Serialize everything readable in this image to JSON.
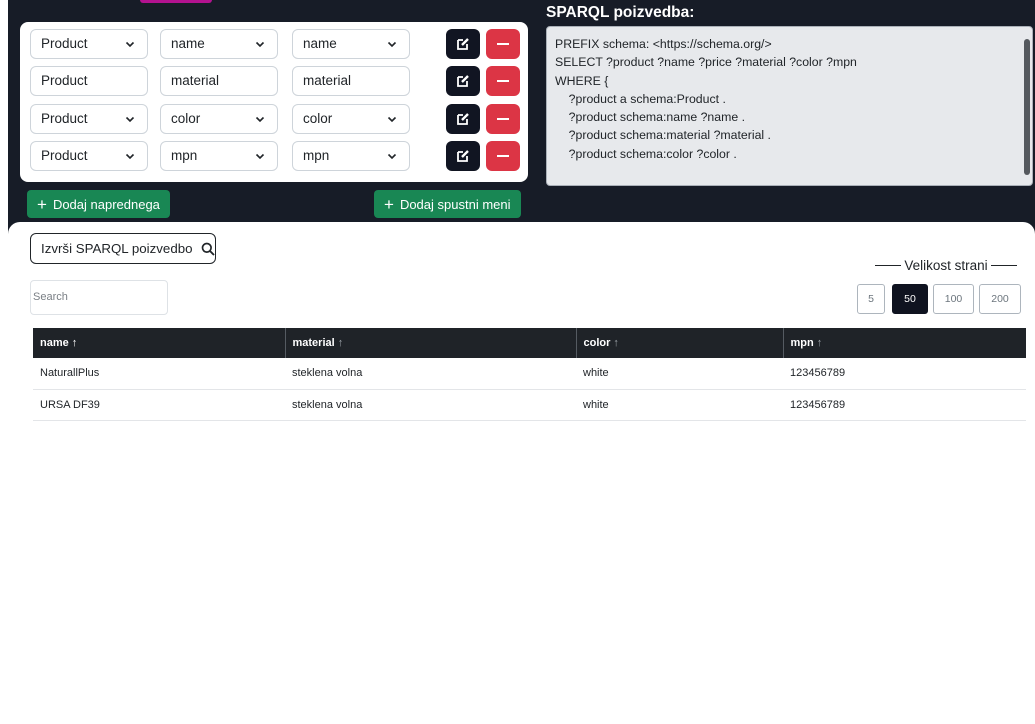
{
  "query_builder": {
    "rows": [
      {
        "type": "dropdown",
        "cls": "Product",
        "prop": "name",
        "alias": "name"
      },
      {
        "type": "text",
        "cls": "Product",
        "prop": "material",
        "alias": "material"
      },
      {
        "type": "dropdown",
        "cls": "Product",
        "prop": "color",
        "alias": "color"
      },
      {
        "type": "dropdown",
        "cls": "Product",
        "prop": "mpn",
        "alias": "mpn"
      }
    ],
    "add_advanced_label": "Dodaj naprednega",
    "add_dropdown_label": "Dodaj spustni meni"
  },
  "sparql": {
    "title": "SPARQL poizvedba:",
    "lines": [
      "PREFIX schema: <https://schema.org/>",
      "SELECT ?product ?name ?price ?material ?color ?mpn",
      "WHERE {",
      "    ?product a schema:Product .",
      "    ?product schema:name ?name .",
      "    ?product schema:material ?material .",
      "    ?product schema:color ?color ."
    ]
  },
  "results": {
    "run_button_label": "Izvrši SPARQL poizvedbo",
    "search_placeholder": "Search",
    "page_size_label": "Velikost strani",
    "page_sizes": [
      "5",
      "50",
      "100",
      "200"
    ],
    "active_page_size": "50",
    "columns": [
      "name",
      "material",
      "color",
      "mpn"
    ],
    "sort_arrow": "↑",
    "rows": [
      [
        "NaturallPlus",
        "steklena volna",
        "white",
        "123456789"
      ],
      [
        "URSA DF39",
        "steklena volna",
        "white",
        "123456789"
      ]
    ]
  },
  "colors": {
    "background": "#171c27",
    "add_button": "#198754",
    "delete_button": "#dc3545",
    "edit_button": "#111522",
    "table_header": "#1f2328"
  }
}
